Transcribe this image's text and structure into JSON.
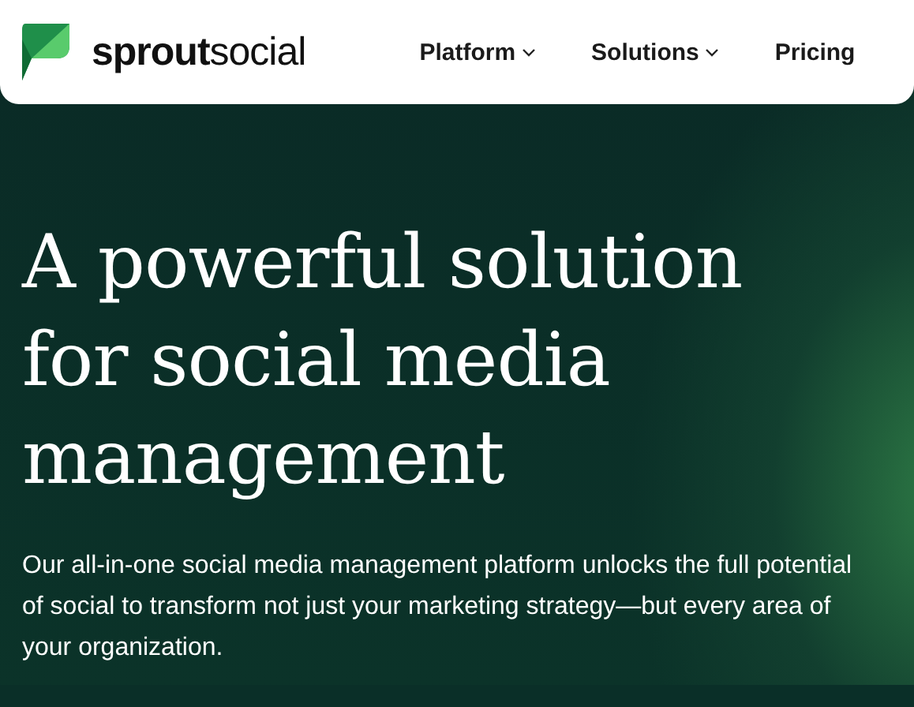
{
  "header": {
    "logo": "**sprout**social",
    "nav": [
      {
        "label": "Platform",
        "kind": "dropdown"
      },
      {
        "label": "Solutions",
        "kind": "dropdown"
      },
      {
        "label": "Pricing",
        "kind": "link"
      }
    ]
  },
  "hero": {
    "title": "A powerful solution for social media management",
    "description": "Our all-in-one social media management platform unlocks the full potential of social to transform not just your marketing strategy—but every area of your organization."
  }
}
